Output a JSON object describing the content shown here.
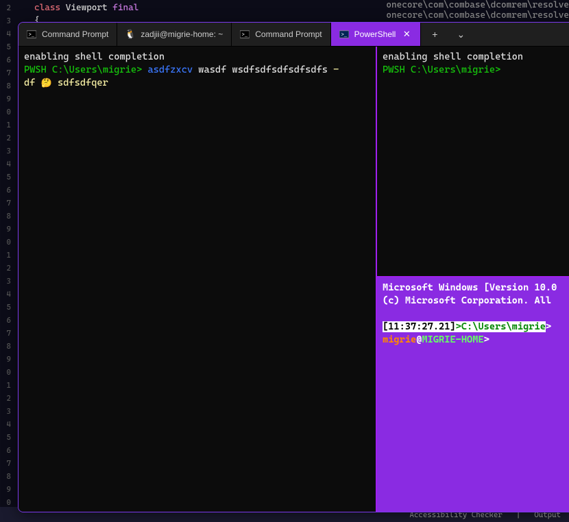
{
  "editor": {
    "gutter_visible_digits": [
      "2",
      "3",
      "4",
      "5",
      "6",
      "7",
      "8",
      "9",
      "0",
      "1",
      "2",
      "3",
      "4",
      "5",
      "6",
      "7",
      "8",
      "9",
      "0",
      "1",
      "2",
      "3",
      "4",
      "5",
      "6",
      "7",
      "8",
      "9",
      "0",
      "1",
      "2",
      "3",
      "4",
      "5",
      "6",
      "7",
      "8",
      "9",
      "0"
    ],
    "code": {
      "kw_class": "class",
      "type_name": "Viewport",
      "kw_final": "final",
      "brace": "{"
    },
    "bg_right_lines": [
      "onecore\\com\\combase\\dcomrem\\resolve",
      "onecore\\com\\combase\\dcomrem\\resolve"
    ]
  },
  "statusbar": {
    "access": "Accessibility Checker",
    "output": "Output"
  },
  "tabs": [
    {
      "label": "Command Prompt",
      "icon": "cmd"
    },
    {
      "label": "zadjii@migrie-home: ~",
      "icon": "tux"
    },
    {
      "label": "Command Prompt",
      "icon": "cmd"
    },
    {
      "label": "PowerShell",
      "icon": "ps",
      "active": true
    }
  ],
  "tab_actions": {
    "plus": "+",
    "chevron": "⌄"
  },
  "pane_left": {
    "line1": "enabling shell completion",
    "prompt": "PWSH C:\\Users\\migrie>",
    "cmd1": "asdfzxcv",
    "cmd2": "wasdf wsdfsdfsdfsdfsdfs",
    "dash": "-",
    "line3a": "df ",
    "emoji": "🤔",
    "line3b": " sdfsdfqer"
  },
  "pane_rt": {
    "line1": "enabling shell completion",
    "prompt": "PWSH C:\\Users\\migrie>"
  },
  "pane_rb": {
    "l1": "Microsoft Windows [Version 10.0",
    "l2": "(c) Microsoft Corporation. All",
    "time": "[11:37:27.21]",
    "gt1": ">",
    "path": "C:\\Users\\migrie",
    "gt2": ">",
    "user": "migrie",
    "at": "@",
    "host": "MIGRIE-HOME",
    "gt3": ">"
  }
}
